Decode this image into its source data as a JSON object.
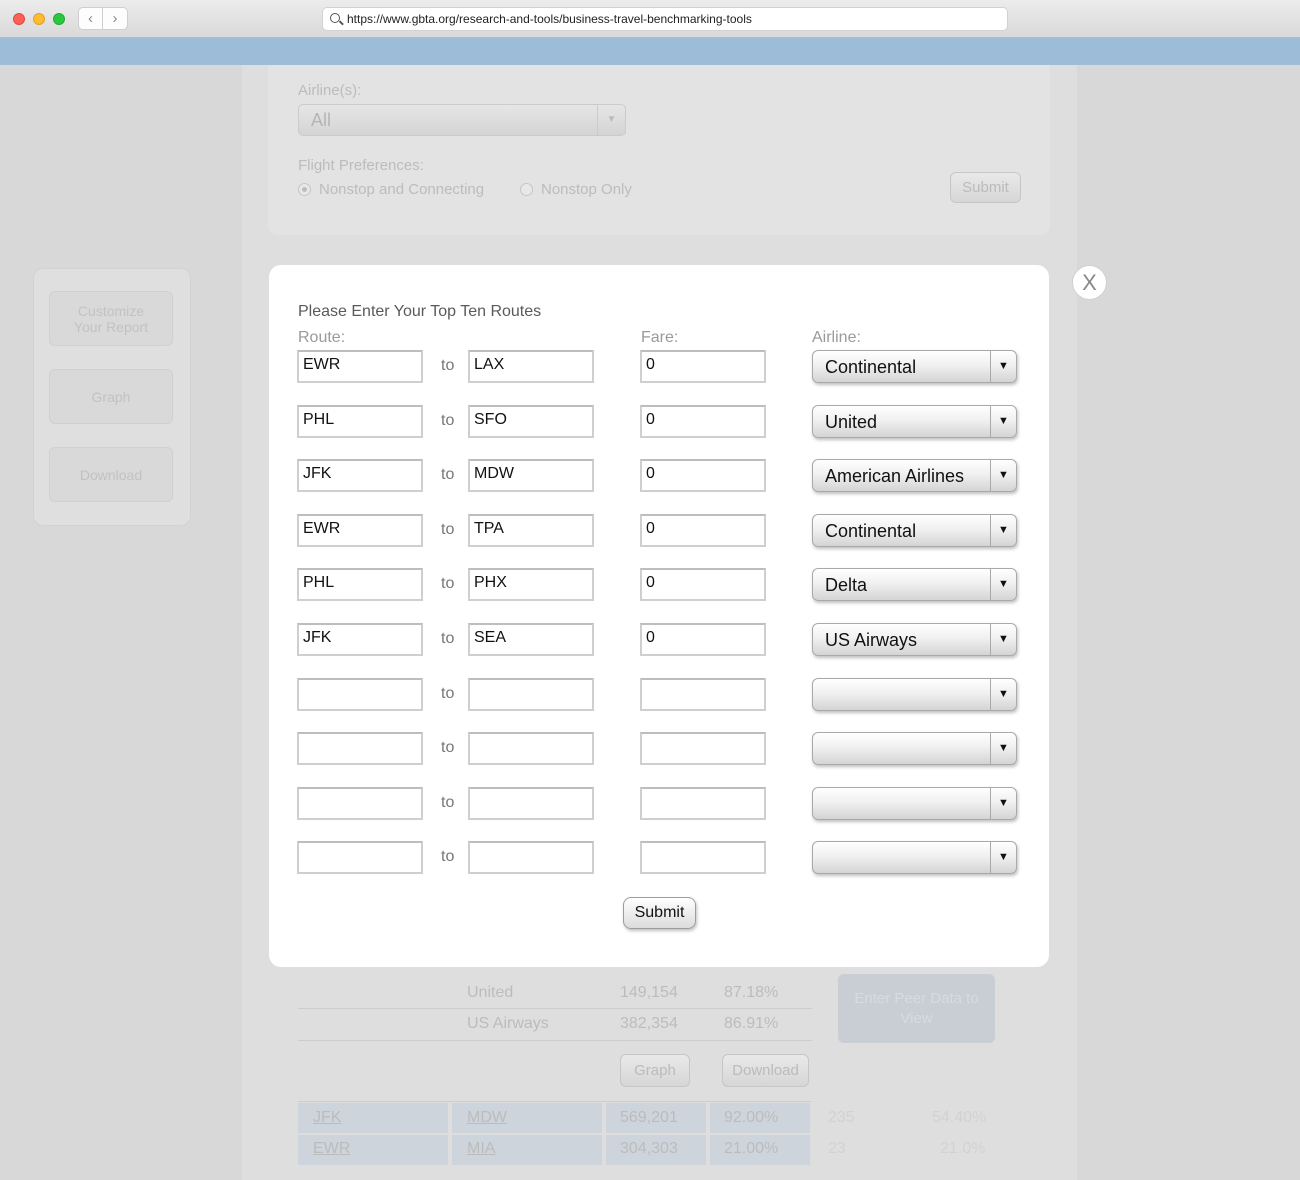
{
  "browser": {
    "url": "https://www.gbta.org/research-and-tools/business-travel-benchmarking-tools",
    "back_glyph": "‹",
    "forward_glyph": "›"
  },
  "background": {
    "airlines_label": "Airline(s):",
    "airlines_value": "All",
    "flight_pref_label": "Flight Preferences:",
    "option_nonstop_connecting": "Nonstop and Connecting",
    "option_nonstop_only": "Nonstop Only",
    "submit_label": "Submit",
    "sidebar": {
      "customize_label": "Customize Your Report",
      "graph_label": "Graph",
      "download_label": "Download"
    },
    "table_rows": [
      {
        "airline": "United",
        "value": "149,154",
        "percent": "87.18%"
      },
      {
        "airline": "US Airways",
        "value": "382,354",
        "percent": "86.91%"
      }
    ],
    "peer_button": "Enter Peer Data to View",
    "graph_button": "Graph",
    "download_button": "Download",
    "route_rows": [
      {
        "from": "JFK",
        "to": "MDW",
        "value": "569,201",
        "percent": "92.00%",
        "extra1": "235",
        "extra2": "54.40%"
      },
      {
        "from": "EWR",
        "to": "MIA",
        "value": "304,303",
        "percent": "21.00%",
        "extra1": "23",
        "extra2": "21.0%"
      }
    ]
  },
  "modal": {
    "title": "Please Enter Your Top Ten Routes",
    "route_label": "Route:",
    "fare_label": "Fare:",
    "airline_label": "Airline:",
    "to_label": "to",
    "close_label": "X",
    "arrow_glyph": "▼",
    "submit_label": "Submit",
    "routes": [
      {
        "from": "EWR",
        "to": "LAX",
        "fare": "0",
        "airline": "Continental"
      },
      {
        "from": "PHL",
        "to": "SFO",
        "fare": "0",
        "airline": "United"
      },
      {
        "from": "JFK",
        "to": "MDW",
        "fare": "0",
        "airline": "American Airlines"
      },
      {
        "from": "EWR",
        "to": "TPA",
        "fare": "0",
        "airline": "Continental"
      },
      {
        "from": "PHL",
        "to": "PHX",
        "fare": "0",
        "airline": "Delta"
      },
      {
        "from": "JFK",
        "to": "SEA",
        "fare": "0",
        "airline": "US Airways"
      },
      {
        "from": "",
        "to": "",
        "fare": "",
        "airline": ""
      },
      {
        "from": "",
        "to": "",
        "fare": "",
        "airline": ""
      },
      {
        "from": "",
        "to": "",
        "fare": "",
        "airline": ""
      },
      {
        "from": "",
        "to": "",
        "fare": "",
        "airline": ""
      }
    ]
  }
}
